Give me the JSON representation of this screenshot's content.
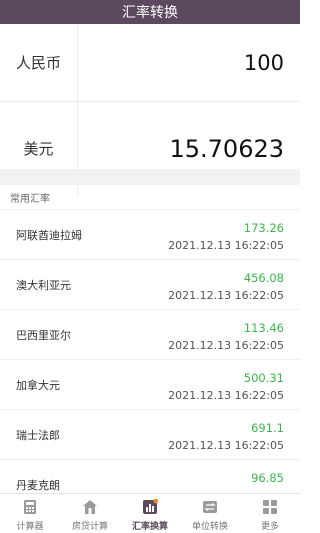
{
  "header": {
    "title": "汇率转换"
  },
  "converter": {
    "from": {
      "currency": "人民币",
      "amount": "100"
    },
    "to": {
      "currency": "美元",
      "amount": "15.70623"
    }
  },
  "rates_section": {
    "title": "常用汇率"
  },
  "rates": [
    {
      "currency": "阿联酋迪拉姆",
      "value": "173.26",
      "time": "2021.12.13 16:22:05"
    },
    {
      "currency": "澳大利亚元",
      "value": "456.08",
      "time": "2021.12.13 16:22:05"
    },
    {
      "currency": "巴西里亚尔",
      "value": "113.46",
      "time": "2021.12.13 16:22:05"
    },
    {
      "currency": "加拿大元",
      "value": "500.31",
      "time": "2021.12.13 16:22:05"
    },
    {
      "currency": "瑞士法郎",
      "value": "691.1",
      "time": "2021.12.13 16:22:05"
    },
    {
      "currency": "丹麦克朗",
      "value": "96.85",
      "time": ""
    }
  ],
  "tabbar": {
    "tabs": [
      {
        "label": "计算器",
        "icon": "calculator-icon"
      },
      {
        "label": "房贷计算",
        "icon": "house-icon"
      },
      {
        "label": "汇率换算",
        "icon": "chart-icon",
        "active": true
      },
      {
        "label": "单位转换",
        "icon": "swap-icon"
      },
      {
        "label": "更多",
        "icon": "grid-icon"
      }
    ]
  },
  "colors": {
    "header": "#5b4a5e",
    "rate_value": "#3fb34f",
    "active_tab": "#5b4a5e"
  }
}
